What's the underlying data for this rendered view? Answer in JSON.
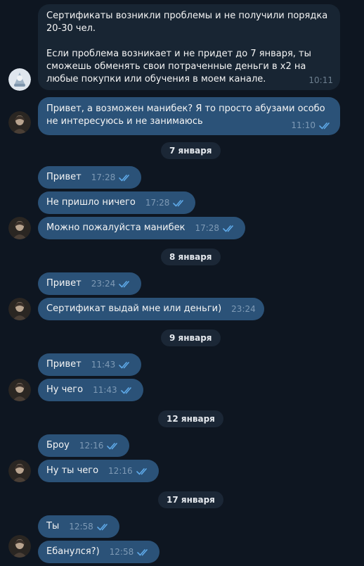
{
  "messages": [
    {
      "text": "Сертификаты возникли проблемы и не получили порядка 20-30 чел.\n\nЕсли проблема возникает и не придет до 7 января, ты сможешь обменять свои потраченные деньги в х2 на любые покупки или обучения в моем канале.",
      "time": "10:11",
      "dir": "in"
    },
    {
      "text": "Привет, а возможен манибек? Я то просто абузами особо не интересуюсь и не занимаюсь",
      "time": "11:10",
      "dir": "out"
    },
    {
      "text": "Привет",
      "time": "17:28",
      "dir": "out"
    },
    {
      "text": "Не пришло ничего",
      "time": "17:28",
      "dir": "out"
    },
    {
      "text": "Можно пожалуйста манибек",
      "time": "17:28",
      "dir": "out"
    },
    {
      "text": "Привет",
      "time": "23:24",
      "dir": "out"
    },
    {
      "text": "Сертификат выдай мне или деньги)",
      "time": "23:24",
      "dir": "out"
    },
    {
      "text": "Привет",
      "time": "11:43",
      "dir": "out"
    },
    {
      "text": "Ну чего",
      "time": "11:43",
      "dir": "out"
    },
    {
      "text": "Броу",
      "time": "12:16",
      "dir": "out"
    },
    {
      "text": "Ну ты чего",
      "time": "12:16",
      "dir": "out"
    },
    {
      "text": "Ты",
      "time": "12:58",
      "dir": "out"
    },
    {
      "text": "Ебанулся?)",
      "time": "12:58",
      "dir": "out"
    }
  ],
  "dates": [
    "7 января",
    "8 января",
    "9 января",
    "12 января",
    "17 января"
  ],
  "colors": {
    "background": "#0e1621",
    "incoming_bubble": "#182533",
    "outgoing_bubble": "#2b5278",
    "date_pill": "#1b2736",
    "read_ticks": "#5ea9e8"
  },
  "icons": {
    "read_status": "double-check-icon"
  }
}
